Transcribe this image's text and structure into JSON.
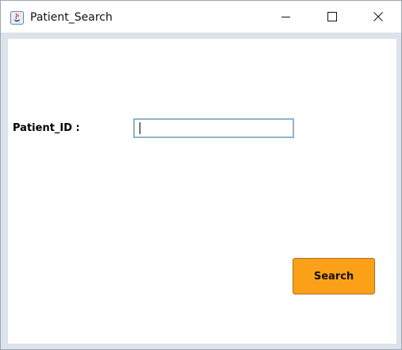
{
  "window": {
    "title": "Patient_Search",
    "controls": {
      "minimize": "minimize-icon",
      "maximize": "maximize-icon",
      "close": "close-icon"
    }
  },
  "form": {
    "patient_id_label": "Patient_ID :",
    "patient_id_value": "",
    "search_label": "Search"
  },
  "colors": {
    "button_background": "#fba017",
    "input_border": "#8fb3cf",
    "window_frame": "#dde3ea"
  }
}
